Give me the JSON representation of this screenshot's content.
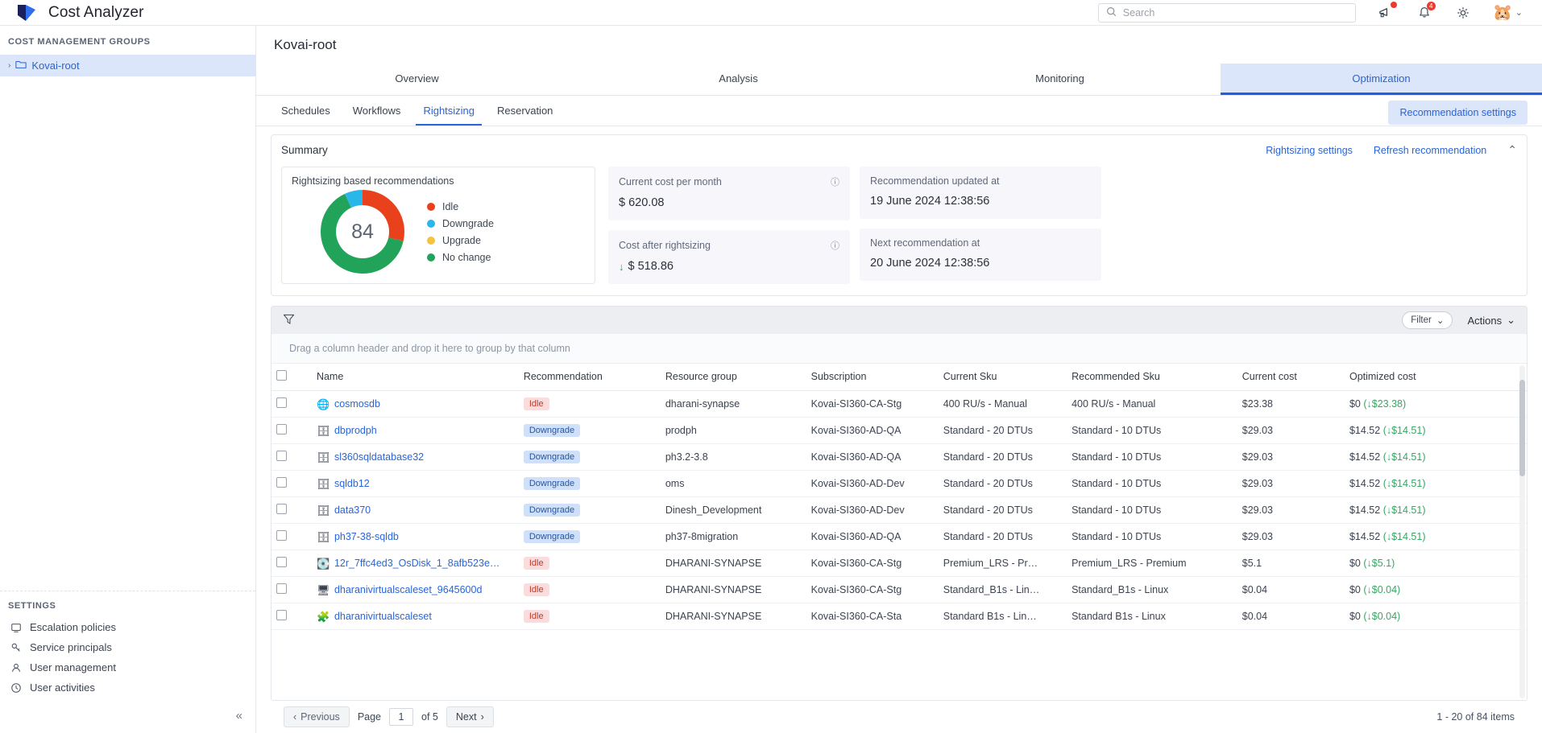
{
  "header": {
    "app_title": "Cost Analyzer",
    "logo_icon": "azure-logo-icon",
    "search_placeholder": "Search",
    "search_value": "",
    "search_icon": "search-icon",
    "announce_icon": "megaphone-icon",
    "announce_badge": "",
    "bell_icon": "bell-icon",
    "bell_badge": "4",
    "gear_icon": "gear-icon",
    "avatar_icon": "pikachu-avatar",
    "avatar_glyph": "⚡",
    "chevron": "⌄"
  },
  "sidebar": {
    "section_label": "COST MANAGEMENT GROUPS",
    "tree": {
      "caret": "›",
      "folder_icon": "folder-icon",
      "label": "Kovai-root"
    },
    "settings_label": "SETTINGS",
    "settings_items": [
      {
        "label": "Escalation policies",
        "icon": "escalation-icon"
      },
      {
        "label": "Service principals",
        "icon": "key-icon"
      },
      {
        "label": "User management",
        "icon": "user-icon"
      },
      {
        "label": "User activities",
        "icon": "activity-icon"
      }
    ],
    "collapse_icon": "collapse-left-icon"
  },
  "page": {
    "title": "Kovai-root",
    "main_tabs": [
      {
        "label": "Overview",
        "active": false
      },
      {
        "label": "Analysis",
        "active": false
      },
      {
        "label": "Monitoring",
        "active": false
      },
      {
        "label": "Optimization",
        "active": true
      }
    ],
    "sub_tabs": [
      {
        "label": "Schedules",
        "active": false
      },
      {
        "label": "Workflows",
        "active": false
      },
      {
        "label": "Rightsizing",
        "active": true
      },
      {
        "label": "Reservation",
        "active": false
      }
    ],
    "recommendation_settings_btn": "Recommendation settings"
  },
  "summary": {
    "title": "Summary",
    "rightsizing_settings_link": "Rightsizing settings",
    "refresh_link": "Refresh recommendation",
    "collapse_caret": "⌃",
    "chart_title": "Rightsizing based recommendations",
    "metrics": [
      {
        "label": "Current cost per month",
        "value": "$ 620.08",
        "arrow": "",
        "info": "ⓘ"
      },
      {
        "label": "Recommendation updated at",
        "value": "19 June 2024 12:38:56",
        "arrow": "",
        "info": ""
      },
      {
        "label": "Cost after rightsizing",
        "value": "$ 518.86",
        "arrow": "↓",
        "info": "ⓘ"
      },
      {
        "label": "Next recommendation at",
        "value": "20 June 2024 12:38:56",
        "arrow": "",
        "info": ""
      }
    ]
  },
  "chart_data": {
    "type": "pie",
    "title": "Rightsizing based recommendations",
    "center_label": "84",
    "categories": [
      "Idle",
      "Downgrade",
      "Upgrade",
      "No change"
    ],
    "values": [
      24,
      6,
      0,
      54
    ],
    "colors": [
      "#e8411c",
      "#29b6e8",
      "#f5c242",
      "#22a35a"
    ],
    "legend_position": "right"
  },
  "toolbar": {
    "funnel_icon": "filter-funnel-icon",
    "filter_label": "Filter",
    "filter_caret": "⌄",
    "actions_label": "Actions",
    "actions_caret": "⌄",
    "group_hint": "Drag a column header and drop it here to group by that column"
  },
  "table": {
    "columns": [
      "Name",
      "Recommendation",
      "Resource group",
      "Subscription",
      "Current Sku",
      "Recommended Sku",
      "Current cost",
      "Optimized cost"
    ],
    "rows": [
      {
        "name": "cosmosdb",
        "icon": "cosmosdb-icon",
        "glyph": "🌐",
        "recommendation": "Idle",
        "rec_type": "idle",
        "resource_group": "dharani-synapse",
        "subscription": "Kovai-SI360-CA-Stg",
        "current_sku": "400 RU/s - Manual",
        "recommended_sku": "400 RU/s - Manual",
        "current_cost": "$23.38",
        "optimized_cost": "$0",
        "saving": "(↓$23.38)"
      },
      {
        "name": "dbprodph",
        "icon": "sql-db-icon",
        "glyph": "🗄",
        "recommendation": "Downgrade",
        "rec_type": "downgrade",
        "resource_group": "prodph",
        "subscription": "Kovai-SI360-AD-QA",
        "current_sku": "Standard - 20 DTUs",
        "recommended_sku": "Standard - 10 DTUs",
        "current_cost": "$29.03",
        "optimized_cost": "$14.52",
        "saving": "(↓$14.51)"
      },
      {
        "name": "sl360sqldatabase32",
        "icon": "sql-db-icon",
        "glyph": "🗄",
        "recommendation": "Downgrade",
        "rec_type": "downgrade",
        "resource_group": "ph3.2-3.8",
        "subscription": "Kovai-SI360-AD-QA",
        "current_sku": "Standard - 20 DTUs",
        "recommended_sku": "Standard - 10 DTUs",
        "current_cost": "$29.03",
        "optimized_cost": "$14.52",
        "saving": "(↓$14.51)"
      },
      {
        "name": "sqldb12",
        "icon": "sql-db-icon",
        "glyph": "🗄",
        "recommendation": "Downgrade",
        "rec_type": "downgrade",
        "resource_group": "oms",
        "subscription": "Kovai-SI360-AD-Dev",
        "current_sku": "Standard - 20 DTUs",
        "recommended_sku": "Standard - 10 DTUs",
        "current_cost": "$29.03",
        "optimized_cost": "$14.52",
        "saving": "(↓$14.51)"
      },
      {
        "name": "data370",
        "icon": "sql-db-icon",
        "glyph": "🗄",
        "recommendation": "Downgrade",
        "rec_type": "downgrade",
        "resource_group": "Dinesh_Development",
        "subscription": "Kovai-SI360-AD-Dev",
        "current_sku": "Standard - 20 DTUs",
        "recommended_sku": "Standard - 10 DTUs",
        "current_cost": "$29.03",
        "optimized_cost": "$14.52",
        "saving": "(↓$14.51)"
      },
      {
        "name": "ph37-38-sqldb",
        "icon": "sql-db-icon",
        "glyph": "🗄",
        "recommendation": "Downgrade",
        "rec_type": "downgrade",
        "resource_group": "ph37-8migration",
        "subscription": "Kovai-SI360-AD-QA",
        "current_sku": "Standard - 20 DTUs",
        "recommended_sku": "Standard - 10 DTUs",
        "current_cost": "$29.03",
        "optimized_cost": "$14.52",
        "saving": "(↓$14.51)"
      },
      {
        "name": "12r_7ffc4ed3_OsDisk_1_8afb523e…",
        "icon": "disk-icon",
        "glyph": "💽",
        "recommendation": "Idle",
        "rec_type": "idle",
        "resource_group": "DHARANI-SYNAPSE",
        "subscription": "Kovai-SI360-CA-Stg",
        "current_sku": "Premium_LRS - Pr…",
        "recommended_sku": "Premium_LRS - Premium",
        "current_cost": "$5.1",
        "optimized_cost": "$0",
        "saving": "(↓$5.1)"
      },
      {
        "name": "dharanivirtualscaleset_9645600d",
        "icon": "vm-icon",
        "glyph": "🖥",
        "recommendation": "Idle",
        "rec_type": "idle",
        "resource_group": "DHARANI-SYNAPSE",
        "subscription": "Kovai-SI360-CA-Stg",
        "current_sku": "Standard_B1s - Lin…",
        "recommended_sku": "Standard_B1s - Linux",
        "current_cost": "$0.04",
        "optimized_cost": "$0",
        "saving": "(↓$0.04)"
      },
      {
        "name": "dharanivirtualscaleset",
        "icon": "vmss-icon",
        "glyph": "🧩",
        "recommendation": "Idle",
        "rec_type": "idle",
        "resource_group": "DHARANI-SYNAPSE",
        "subscription": "Kovai-SI360-CA-Sta",
        "current_sku": "Standard  B1s - Lin…",
        "recommended_sku": "Standard  B1s - Linux",
        "current_cost": "$0.04",
        "optimized_cost": "$0",
        "saving": "(↓$0.04)"
      }
    ]
  },
  "pagination": {
    "previous": "Previous",
    "prev_caret": "‹",
    "page_label": "Page",
    "page_value": "1",
    "of_label": "of 5",
    "next": "Next",
    "next_caret": "›",
    "summary": "1 - 20 of 84 items"
  }
}
